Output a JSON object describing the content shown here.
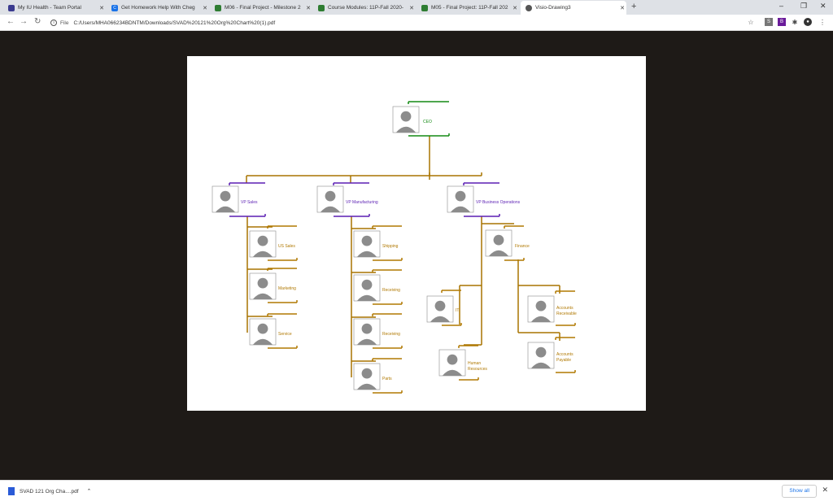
{
  "tabs": [
    {
      "title": "My IU Health - Team Portal",
      "color": "#3b3b8f"
    },
    {
      "title": "Get Homework Help With Cheg",
      "color": "#1a73e8"
    },
    {
      "title": "M06 - Final Project - Milestone 2",
      "color": "#2e7d32"
    },
    {
      "title": "Course Modules: 11P-Fall 2020-",
      "color": "#2e7d32"
    },
    {
      "title": "M05 - Final Project: 11P-Fall 202",
      "color": "#2e7d32"
    },
    {
      "title": "Visio-Drawing3",
      "color": "#555555"
    }
  ],
  "address": {
    "scheme": "File",
    "url": "C:/Users/MHA066234BDNTM/Downloads/SVAD%20121%20Org%20Chart%20(1).pdf"
  },
  "download": {
    "filename": "SVAD 121 Org Cha....pdf",
    "show_all": "Show all"
  },
  "org": {
    "colors": {
      "ceo": "#138a13",
      "vp": "#5b1fb3",
      "staff": "#b07800",
      "connector": "#a87400",
      "avatar": "#8c8c8c"
    },
    "ceo": "CEO",
    "vps": [
      "VP Sales",
      "VP Manufacturing",
      "VP Business Operations"
    ],
    "sales": [
      "US Sales",
      "Marketing",
      "Service"
    ],
    "manufacturing": [
      "Shipping",
      "Receiving",
      "Receiving",
      "Parts"
    ],
    "operations": [
      "Finance",
      "IT",
      "Human Resources",
      "Accounts Receivable",
      "Accounts Payable"
    ]
  }
}
